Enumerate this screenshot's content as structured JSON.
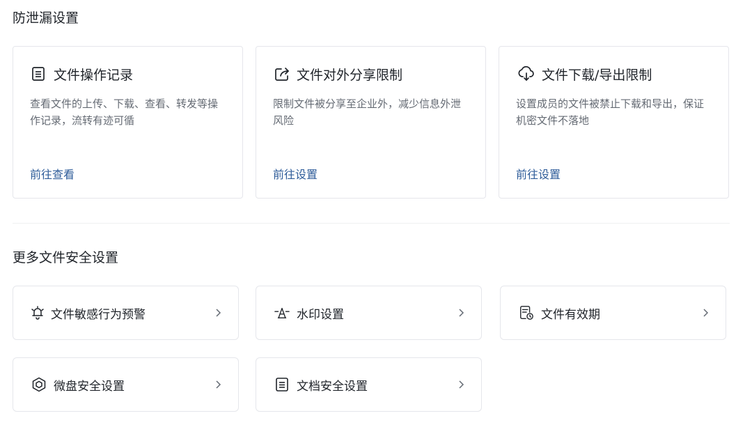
{
  "sections": {
    "dlp_title": "防泄漏设置",
    "more_title": "更多文件安全设置"
  },
  "cards": [
    {
      "title": "文件操作记录",
      "icon": "document-icon",
      "desc": "查看文件的上传、下载、查看、转发等操作记录，流转有迹可循",
      "link": "前往查看"
    },
    {
      "title": "文件对外分享限制",
      "icon": "share-out-icon",
      "desc": "限制文件被分享至企业外，减少信息外泄风险",
      "link": "前往设置"
    },
    {
      "title": "文件下载/导出限制",
      "icon": "cloud-download-icon",
      "desc": "设置成员的文件被禁止下载和导出，保证机密文件不落地",
      "link": "前往设置"
    }
  ],
  "entries": [
    {
      "label": "文件敏感行为预警",
      "icon": "bell-alert-icon"
    },
    {
      "label": "水印设置",
      "icon": "watermark-icon"
    },
    {
      "label": "文件有效期",
      "icon": "file-clock-icon"
    },
    {
      "label": "微盘安全设置",
      "icon": "cube-shield-icon"
    },
    {
      "label": "文档安全设置",
      "icon": "doc-list-icon"
    }
  ]
}
